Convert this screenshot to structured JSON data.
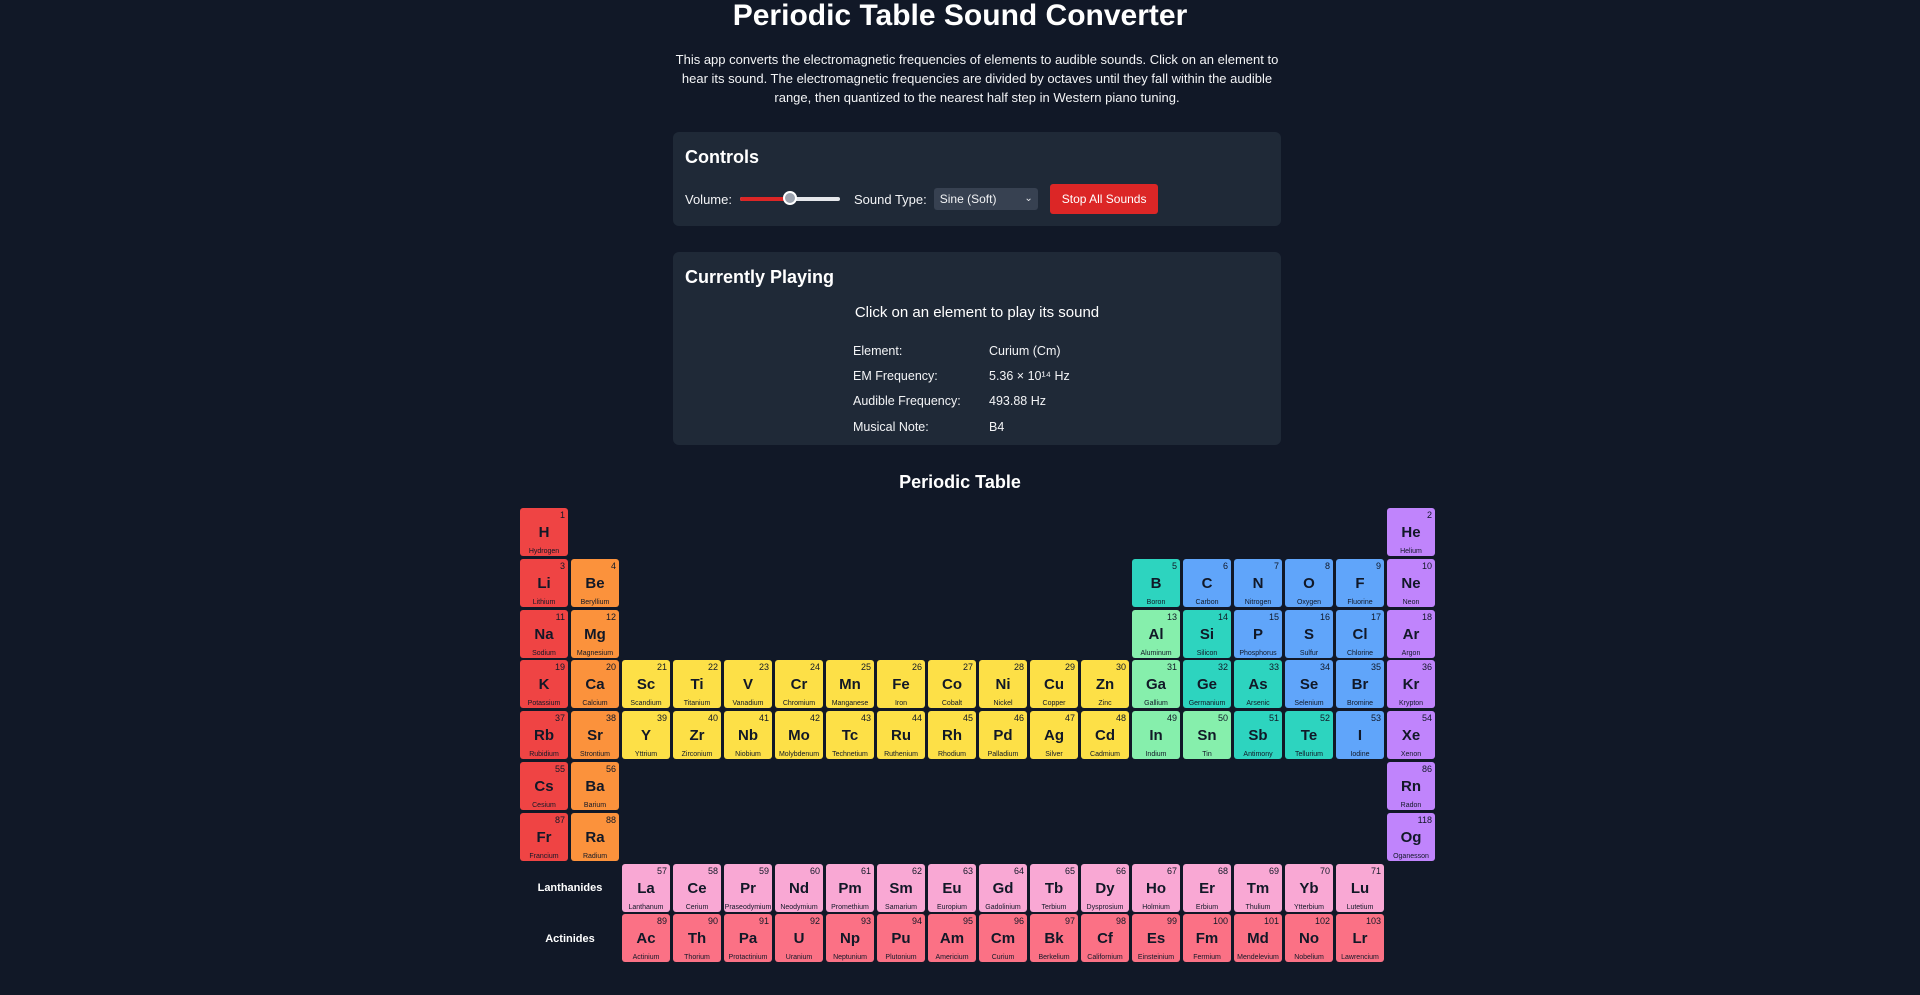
{
  "header": {
    "title": "Periodic Table Sound Converter",
    "description": "This app converts the electromagnetic frequencies of elements to audible sounds. Click on an element to hear its sound. The electromagnetic frequencies are divided by octaves until they fall within the audible range, then quantized to the nearest half step in Western piano tuning."
  },
  "controls": {
    "heading": "Controls",
    "volume_label": "Volume:",
    "volume_value": 0.5,
    "sound_type_label": "Sound Type:",
    "sound_type_selected": "Sine (Soft)",
    "stop_button": "Stop All Sounds"
  },
  "playing": {
    "heading": "Currently Playing",
    "hint": "Click on an element to play its sound",
    "rows": [
      {
        "key": "Element:",
        "value": "Curium (Cm)"
      },
      {
        "key": "EM Frequency:",
        "value": "5.36 × 10¹⁴ Hz"
      },
      {
        "key": "Audible Frequency:",
        "value": "493.88 Hz"
      },
      {
        "key": "Musical Note:",
        "value": "B4"
      }
    ]
  },
  "table": {
    "heading": "Periodic Table",
    "lanthanides_label": "Lanthanides",
    "actinides_label": "Actinides",
    "colors": {
      "alkali": "#ef4444",
      "alkaline": "#fb923c",
      "transition": "#fde047",
      "post": "#86efac",
      "metalloid": "#2dd4bf",
      "nonmetal": "#60a5fa",
      "noble": "#c084fc",
      "lanthanide": "#f9a8d4",
      "actinide": "#fb7185"
    },
    "elements": [
      {
        "n": 1,
        "s": "H",
        "name": "Hydrogen",
        "g": 1,
        "p": 1,
        "c": "alkali"
      },
      {
        "n": 2,
        "s": "He",
        "name": "Helium",
        "g": 18,
        "p": 1,
        "c": "noble"
      },
      {
        "n": 3,
        "s": "Li",
        "name": "Lithium",
        "g": 1,
        "p": 2,
        "c": "alkali"
      },
      {
        "n": 4,
        "s": "Be",
        "name": "Beryllium",
        "g": 2,
        "p": 2,
        "c": "alkaline"
      },
      {
        "n": 5,
        "s": "B",
        "name": "Boron",
        "g": 13,
        "p": 2,
        "c": "metalloid"
      },
      {
        "n": 6,
        "s": "C",
        "name": "Carbon",
        "g": 14,
        "p": 2,
        "c": "nonmetal"
      },
      {
        "n": 7,
        "s": "N",
        "name": "Nitrogen",
        "g": 15,
        "p": 2,
        "c": "nonmetal"
      },
      {
        "n": 8,
        "s": "O",
        "name": "Oxygen",
        "g": 16,
        "p": 2,
        "c": "nonmetal"
      },
      {
        "n": 9,
        "s": "F",
        "name": "Fluorine",
        "g": 17,
        "p": 2,
        "c": "nonmetal"
      },
      {
        "n": 10,
        "s": "Ne",
        "name": "Neon",
        "g": 18,
        "p": 2,
        "c": "noble"
      },
      {
        "n": 11,
        "s": "Na",
        "name": "Sodium",
        "g": 1,
        "p": 3,
        "c": "alkali"
      },
      {
        "n": 12,
        "s": "Mg",
        "name": "Magnesium",
        "g": 2,
        "p": 3,
        "c": "alkaline"
      },
      {
        "n": 13,
        "s": "Al",
        "name": "Aluminum",
        "g": 13,
        "p": 3,
        "c": "post"
      },
      {
        "n": 14,
        "s": "Si",
        "name": "Silicon",
        "g": 14,
        "p": 3,
        "c": "metalloid"
      },
      {
        "n": 15,
        "s": "P",
        "name": "Phosphorus",
        "g": 15,
        "p": 3,
        "c": "nonmetal"
      },
      {
        "n": 16,
        "s": "S",
        "name": "Sulfur",
        "g": 16,
        "p": 3,
        "c": "nonmetal"
      },
      {
        "n": 17,
        "s": "Cl",
        "name": "Chlorine",
        "g": 17,
        "p": 3,
        "c": "nonmetal"
      },
      {
        "n": 18,
        "s": "Ar",
        "name": "Argon",
        "g": 18,
        "p": 3,
        "c": "noble"
      },
      {
        "n": 19,
        "s": "K",
        "name": "Potassium",
        "g": 1,
        "p": 4,
        "c": "alkali"
      },
      {
        "n": 20,
        "s": "Ca",
        "name": "Calcium",
        "g": 2,
        "p": 4,
        "c": "alkaline"
      },
      {
        "n": 21,
        "s": "Sc",
        "name": "Scandium",
        "g": 3,
        "p": 4,
        "c": "transition"
      },
      {
        "n": 22,
        "s": "Ti",
        "name": "Titanium",
        "g": 4,
        "p": 4,
        "c": "transition"
      },
      {
        "n": 23,
        "s": "V",
        "name": "Vanadium",
        "g": 5,
        "p": 4,
        "c": "transition"
      },
      {
        "n": 24,
        "s": "Cr",
        "name": "Chromium",
        "g": 6,
        "p": 4,
        "c": "transition"
      },
      {
        "n": 25,
        "s": "Mn",
        "name": "Manganese",
        "g": 7,
        "p": 4,
        "c": "transition"
      },
      {
        "n": 26,
        "s": "Fe",
        "name": "Iron",
        "g": 8,
        "p": 4,
        "c": "transition"
      },
      {
        "n": 27,
        "s": "Co",
        "name": "Cobalt",
        "g": 9,
        "p": 4,
        "c": "transition"
      },
      {
        "n": 28,
        "s": "Ni",
        "name": "Nickel",
        "g": 10,
        "p": 4,
        "c": "transition"
      },
      {
        "n": 29,
        "s": "Cu",
        "name": "Copper",
        "g": 11,
        "p": 4,
        "c": "transition"
      },
      {
        "n": 30,
        "s": "Zn",
        "name": "Zinc",
        "g": 12,
        "p": 4,
        "c": "transition"
      },
      {
        "n": 31,
        "s": "Ga",
        "name": "Gallium",
        "g": 13,
        "p": 4,
        "c": "post"
      },
      {
        "n": 32,
        "s": "Ge",
        "name": "Germanium",
        "g": 14,
        "p": 4,
        "c": "metalloid"
      },
      {
        "n": 33,
        "s": "As",
        "name": "Arsenic",
        "g": 15,
        "p": 4,
        "c": "metalloid"
      },
      {
        "n": 34,
        "s": "Se",
        "name": "Selenium",
        "g": 16,
        "p": 4,
        "c": "nonmetal"
      },
      {
        "n": 35,
        "s": "Br",
        "name": "Bromine",
        "g": 17,
        "p": 4,
        "c": "nonmetal"
      },
      {
        "n": 36,
        "s": "Kr",
        "name": "Krypton",
        "g": 18,
        "p": 4,
        "c": "noble"
      },
      {
        "n": 37,
        "s": "Rb",
        "name": "Rubidium",
        "g": 1,
        "p": 5,
        "c": "alkali"
      },
      {
        "n": 38,
        "s": "Sr",
        "name": "Strontium",
        "g": 2,
        "p": 5,
        "c": "alkaline"
      },
      {
        "n": 39,
        "s": "Y",
        "name": "Yttrium",
        "g": 3,
        "p": 5,
        "c": "transition"
      },
      {
        "n": 40,
        "s": "Zr",
        "name": "Zirconium",
        "g": 4,
        "p": 5,
        "c": "transition"
      },
      {
        "n": 41,
        "s": "Nb",
        "name": "Niobium",
        "g": 5,
        "p": 5,
        "c": "transition"
      },
      {
        "n": 42,
        "s": "Mo",
        "name": "Molybdenum",
        "g": 6,
        "p": 5,
        "c": "transition"
      },
      {
        "n": 43,
        "s": "Tc",
        "name": "Technetium",
        "g": 7,
        "p": 5,
        "c": "transition"
      },
      {
        "n": 44,
        "s": "Ru",
        "name": "Ruthenium",
        "g": 8,
        "p": 5,
        "c": "transition"
      },
      {
        "n": 45,
        "s": "Rh",
        "name": "Rhodium",
        "g": 9,
        "p": 5,
        "c": "transition"
      },
      {
        "n": 46,
        "s": "Pd",
        "name": "Palladium",
        "g": 10,
        "p": 5,
        "c": "transition"
      },
      {
        "n": 47,
        "s": "Ag",
        "name": "Silver",
        "g": 11,
        "p": 5,
        "c": "transition"
      },
      {
        "n": 48,
        "s": "Cd",
        "name": "Cadmium",
        "g": 12,
        "p": 5,
        "c": "transition"
      },
      {
        "n": 49,
        "s": "In",
        "name": "Indium",
        "g": 13,
        "p": 5,
        "c": "post"
      },
      {
        "n": 50,
        "s": "Sn",
        "name": "Tin",
        "g": 14,
        "p": 5,
        "c": "post"
      },
      {
        "n": 51,
        "s": "Sb",
        "name": "Antimony",
        "g": 15,
        "p": 5,
        "c": "metalloid"
      },
      {
        "n": 52,
        "s": "Te",
        "name": "Tellurium",
        "g": 16,
        "p": 5,
        "c": "metalloid"
      },
      {
        "n": 53,
        "s": "I",
        "name": "Iodine",
        "g": 17,
        "p": 5,
        "c": "nonmetal"
      },
      {
        "n": 54,
        "s": "Xe",
        "name": "Xenon",
        "g": 18,
        "p": 5,
        "c": "noble"
      },
      {
        "n": 55,
        "s": "Cs",
        "name": "Cesium",
        "g": 1,
        "p": 6,
        "c": "alkali"
      },
      {
        "n": 56,
        "s": "Ba",
        "name": "Barium",
        "g": 2,
        "p": 6,
        "c": "alkaline"
      },
      {
        "n": 86,
        "s": "Rn",
        "name": "Radon",
        "g": 18,
        "p": 6,
        "c": "noble"
      },
      {
        "n": 87,
        "s": "Fr",
        "name": "Francium",
        "g": 1,
        "p": 7,
        "c": "alkali"
      },
      {
        "n": 88,
        "s": "Ra",
        "name": "Radium",
        "g": 2,
        "p": 7,
        "c": "alkaline"
      },
      {
        "n": 118,
        "s": "Og",
        "name": "Oganesson",
        "g": 18,
        "p": 7,
        "c": "noble"
      },
      {
        "n": 57,
        "s": "La",
        "name": "Lanthanum",
        "g": 3,
        "p": 8,
        "c": "lanthanide"
      },
      {
        "n": 58,
        "s": "Ce",
        "name": "Cerium",
        "g": 4,
        "p": 8,
        "c": "lanthanide"
      },
      {
        "n": 59,
        "s": "Pr",
        "name": "Praseodymium",
        "g": 5,
        "p": 8,
        "c": "lanthanide"
      },
      {
        "n": 60,
        "s": "Nd",
        "name": "Neodymium",
        "g": 6,
        "p": 8,
        "c": "lanthanide"
      },
      {
        "n": 61,
        "s": "Pm",
        "name": "Promethium",
        "g": 7,
        "p": 8,
        "c": "lanthanide"
      },
      {
        "n": 62,
        "s": "Sm",
        "name": "Samarium",
        "g": 8,
        "p": 8,
        "c": "lanthanide"
      },
      {
        "n": 63,
        "s": "Eu",
        "name": "Europium",
        "g": 9,
        "p": 8,
        "c": "lanthanide"
      },
      {
        "n": 64,
        "s": "Gd",
        "name": "Gadolinium",
        "g": 10,
        "p": 8,
        "c": "lanthanide"
      },
      {
        "n": 65,
        "s": "Tb",
        "name": "Terbium",
        "g": 11,
        "p": 8,
        "c": "lanthanide"
      },
      {
        "n": 66,
        "s": "Dy",
        "name": "Dysprosium",
        "g": 12,
        "p": 8,
        "c": "lanthanide"
      },
      {
        "n": 67,
        "s": "Ho",
        "name": "Holmium",
        "g": 13,
        "p": 8,
        "c": "lanthanide"
      },
      {
        "n": 68,
        "s": "Er",
        "name": "Erbium",
        "g": 14,
        "p": 8,
        "c": "lanthanide"
      },
      {
        "n": 69,
        "s": "Tm",
        "name": "Thulium",
        "g": 15,
        "p": 8,
        "c": "lanthanide"
      },
      {
        "n": 70,
        "s": "Yb",
        "name": "Ytterbium",
        "g": 16,
        "p": 8,
        "c": "lanthanide"
      },
      {
        "n": 71,
        "s": "Lu",
        "name": "Lutetium",
        "g": 17,
        "p": 8,
        "c": "lanthanide"
      },
      {
        "n": 89,
        "s": "Ac",
        "name": "Actinium",
        "g": 3,
        "p": 9,
        "c": "actinide"
      },
      {
        "n": 90,
        "s": "Th",
        "name": "Thorium",
        "g": 4,
        "p": 9,
        "c": "actinide"
      },
      {
        "n": 91,
        "s": "Pa",
        "name": "Protactinium",
        "g": 5,
        "p": 9,
        "c": "actinide"
      },
      {
        "n": 92,
        "s": "U",
        "name": "Uranium",
        "g": 6,
        "p": 9,
        "c": "actinide"
      },
      {
        "n": 93,
        "s": "Np",
        "name": "Neptunium",
        "g": 7,
        "p": 9,
        "c": "actinide"
      },
      {
        "n": 94,
        "s": "Pu",
        "name": "Plutonium",
        "g": 8,
        "p": 9,
        "c": "actinide"
      },
      {
        "n": 95,
        "s": "Am",
        "name": "Americium",
        "g": 9,
        "p": 9,
        "c": "actinide"
      },
      {
        "n": 96,
        "s": "Cm",
        "name": "Curium",
        "g": 10,
        "p": 9,
        "c": "actinide"
      },
      {
        "n": 97,
        "s": "Bk",
        "name": "Berkelium",
        "g": 11,
        "p": 9,
        "c": "actinide"
      },
      {
        "n": 98,
        "s": "Cf",
        "name": "Californium",
        "g": 12,
        "p": 9,
        "c": "actinide"
      },
      {
        "n": 99,
        "s": "Es",
        "name": "Einsteinium",
        "g": 13,
        "p": 9,
        "c": "actinide"
      },
      {
        "n": 100,
        "s": "Fm",
        "name": "Fermium",
        "g": 14,
        "p": 9,
        "c": "actinide"
      },
      {
        "n": 101,
        "s": "Md",
        "name": "Mendelevium",
        "g": 15,
        "p": 9,
        "c": "actinide"
      },
      {
        "n": 102,
        "s": "No",
        "name": "Nobelium",
        "g": 16,
        "p": 9,
        "c": "actinide"
      },
      {
        "n": 103,
        "s": "Lr",
        "name": "Lawrencium",
        "g": 17,
        "p": 9,
        "c": "actinide"
      }
    ]
  }
}
